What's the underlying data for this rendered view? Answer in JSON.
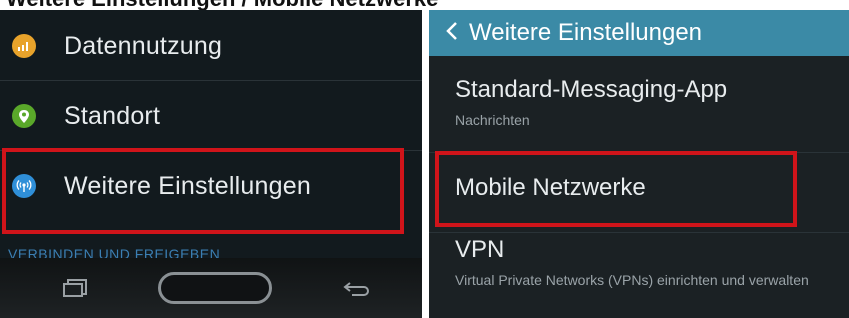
{
  "caption": "Weitere Einstellungen / Mobile Netzwerke",
  "left_panel": {
    "items": [
      {
        "label": "Datennutzung",
        "icon": "data-usage-icon",
        "icon_color": "#e8a32b"
      },
      {
        "label": "Standort",
        "icon": "location-icon",
        "icon_color": "#5aa82a"
      },
      {
        "label": "Weitere Einstellungen",
        "icon": "wireless-icon",
        "icon_color": "#2f8fd8"
      }
    ],
    "section_header": "VERBINDEN UND FREIGEBEN",
    "navbar": {
      "recent": "recent-apps-icon",
      "home": "home-button",
      "back": "back-icon"
    }
  },
  "right_panel": {
    "title": "Weitere Einstellungen",
    "items": [
      {
        "label": "Standard-Messaging-App",
        "sub": "Nachrichten"
      },
      {
        "label": "Mobile Netzwerke",
        "sub": ""
      },
      {
        "label": "VPN",
        "sub": "Virtual Private Networks (VPNs) einrichten und verwalten"
      }
    ]
  },
  "colors": {
    "highlight": "#d0141a",
    "title_bar": "#3b8aa6",
    "section_header": "#3b7fb3"
  }
}
